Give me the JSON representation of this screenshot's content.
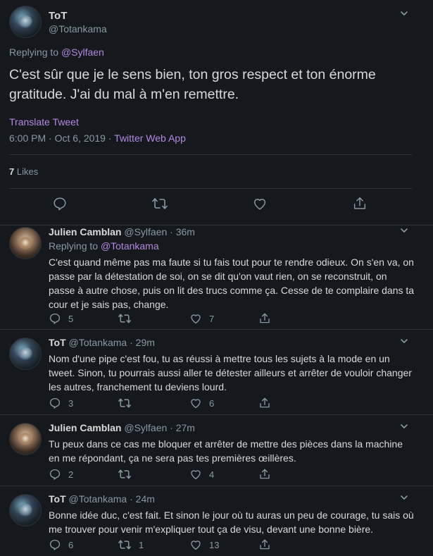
{
  "main_tweet": {
    "name": "ToT",
    "handle": "@Totankama",
    "replying_label": "Replying to",
    "replying_to": "@Sylfaen",
    "text": "C'est sûr que je le sens bien, ton gros respect et ton énorme gratitude. J'ai du mal à m'en remettre.",
    "translate": "Translate Tweet",
    "time": "6:00 PM · Oct 6, 2019",
    "separator": "·",
    "source": "Twitter Web App",
    "likes_count": "7",
    "likes_label": "Likes",
    "icons": [
      "reply-icon",
      "retweet-icon",
      "like-icon",
      "share-icon"
    ]
  },
  "replies": [
    {
      "name": "Julien Camblan",
      "handle": "@Sylfaen",
      "time": "· 36m",
      "replying_label": "Replying to",
      "replying_to": "@Totankama",
      "text": "C'est quand même pas ma faute si tu fais tout pour te rendre odieux. On s'en va, on passe par la détestation de soi, on se dit qu'on vaut rien, on se reconstruit, on passe à autre chose, puis on lit des trucs comme ça. Cesse de te complaire dans ta cour et je sais pas, change.",
      "reply_count": "5",
      "retweet_count": "",
      "like_count": "7"
    },
    {
      "name": "ToT",
      "handle": "@Totankama",
      "time": "· 29m",
      "text": "Nom d'une pipe c'est fou, tu as réussi à mettre tous les sujets à la mode en un tweet. Sinon, tu pourrais aussi aller te détester ailleurs et arrêter de vouloir changer les autres, franchement tu deviens lourd.",
      "reply_count": "3",
      "retweet_count": "",
      "like_count": "6"
    },
    {
      "name": "Julien Camblan",
      "handle": "@Sylfaen",
      "time": "· 27m",
      "text": "Tu peux dans ce cas me bloquer et arrêter de mettre des pièces dans la machine en me répondant, ça ne sera pas tes premières œillères.",
      "reply_count": "2",
      "retweet_count": "",
      "like_count": "4"
    },
    {
      "name": "ToT",
      "handle": "@Totankama",
      "time": "· 24m",
      "text": "Bonne idée duc, c'est fait. Et sinon le jour où tu auras un peu de courage, tu sais où me trouver pour venir m'expliquer tout ça de visu, devant une bonne bière.",
      "reply_count": "6",
      "retweet_count": "1",
      "like_count": "13"
    }
  ],
  "colors": {
    "background": "#15181c",
    "text": "#d9d9d9",
    "muted": "#8899a6",
    "accent": "#b488e0",
    "divider": "#2f3336"
  }
}
